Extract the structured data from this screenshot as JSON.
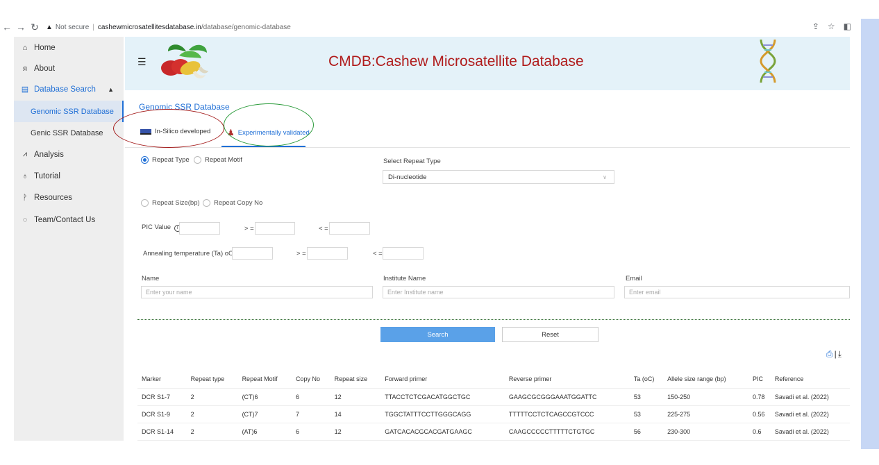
{
  "browser": {
    "security": "Not secure",
    "url_host": "cashewmicrosatellitesdatabase.in",
    "url_path": "/database/genomic-database"
  },
  "sidebar": {
    "home": "Home",
    "about": "About",
    "database_search": "Database Search",
    "genomic": "Genomic SSR Database",
    "genic": "Genic SSR Database",
    "analysis": "Analysis",
    "tutorial": "Tutorial",
    "resources": "Resources",
    "team": "Team/Contact Us"
  },
  "header": {
    "title": "CMDB:Cashew Microsatellite Database"
  },
  "page": {
    "section_title": "Genomic SSR Database",
    "tab_insilico": "In-Silico developed",
    "tab_experimental": "Experimentally validated"
  },
  "form": {
    "radio_repeat_type": "Repeat Type",
    "radio_repeat_motif": "Repeat Motif",
    "select_repeat_type_label": "Select Repeat Type",
    "select_repeat_type_value": "Di-nucleotide",
    "radio_repeat_size": "Repeat Size(bp)",
    "radio_copy_no": "Repeat Copy No",
    "pic_label": "PIC Value",
    "gte": "> =",
    "lte": "< =",
    "ta_label": "Annealing temperature (Ta) oC",
    "name_label": "Name",
    "name_placeholder": "Enter your name",
    "institute_label": "Institute Name",
    "institute_placeholder": "Enter Institute name",
    "email_label": "Email",
    "email_placeholder": "Enter email",
    "search_button": "Search",
    "reset_button": "Reset"
  },
  "table": {
    "headers": [
      "Marker",
      "Repeat type",
      "Repeat Motif",
      "Copy No",
      "Repeat size",
      "Forward primer",
      "Reverse primer",
      "Ta (oC)",
      "Allele size range (bp)",
      "PIC",
      "Reference"
    ],
    "rows": [
      [
        "DCR S1-7",
        "2",
        "(CT)6",
        "6",
        "12",
        "TTACCTCTCGACATGGCTGC",
        "GAAGCGCGGGAAATGGATTC",
        "53",
        "150-250",
        "0.78",
        "Savadi et al. (2022)"
      ],
      [
        "DCR S1-9",
        "2",
        "(CT)7",
        "7",
        "14",
        "TGGCTATTTCCTTGGGCAGG",
        "TTTTTCCTCTCAGCCGTCCC",
        "53",
        "225-275",
        "0.56",
        "Savadi et al. (2022)"
      ],
      [
        "DCR S1-14",
        "2",
        "(AT)6",
        "6",
        "12",
        "GATCACACGCACGATGAAGC",
        "CAAGCCCCCTTTTTCTGTGC",
        "56",
        "230-300",
        "0.6",
        "Savadi et al. (2022)"
      ]
    ]
  },
  "colors": {
    "accent": "#1f6fd6",
    "title_red": "#b01b1b",
    "banner_bg": "#e4f2f9",
    "sidebar_bg": "#eeeeee"
  }
}
